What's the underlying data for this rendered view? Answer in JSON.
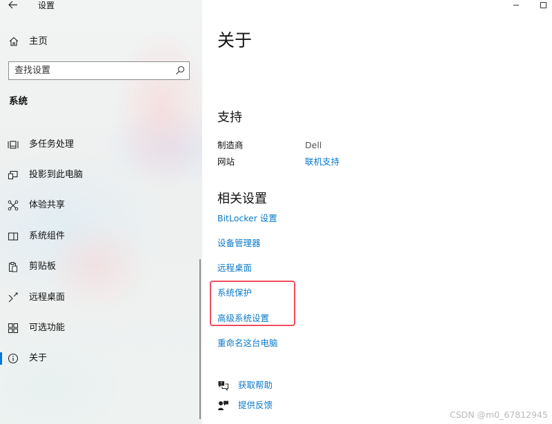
{
  "window": {
    "title": "设置"
  },
  "sidebar": {
    "home_label": "主页",
    "search_placeholder": "查找设置",
    "section_title": "系统",
    "items": [
      {
        "label": "多任务处理",
        "icon": "multitasking-icon"
      },
      {
        "label": "投影到此电脑",
        "icon": "projection-icon"
      },
      {
        "label": "体验共享",
        "icon": "shared-experiences-icon"
      },
      {
        "label": "系统组件",
        "icon": "system-components-icon"
      },
      {
        "label": "剪贴板",
        "icon": "clipboard-icon"
      },
      {
        "label": "远程桌面",
        "icon": "remote-desktop-icon"
      },
      {
        "label": "可选功能",
        "icon": "optional-features-icon"
      },
      {
        "label": "关于",
        "icon": "info-icon",
        "active": true
      }
    ]
  },
  "main": {
    "title": "关于",
    "support": {
      "heading": "支持",
      "manufacturer_label": "制造商",
      "manufacturer_value": "Dell",
      "website_label": "网站",
      "website_value": "联机支持"
    },
    "related": {
      "heading": "相关设置",
      "links": [
        "BitLocker 设置",
        "设备管理器",
        "远程桌面",
        "系统保护",
        "高级系统设置",
        "重命名这台电脑"
      ]
    },
    "help": {
      "get_help": "获取帮助",
      "feedback": "提供反馈"
    }
  },
  "watermark": "CSDN @m0_67812945",
  "colors": {
    "accent": "#0078d7",
    "link": "#0a7ac9",
    "highlight_border": "#ee4b5e"
  }
}
